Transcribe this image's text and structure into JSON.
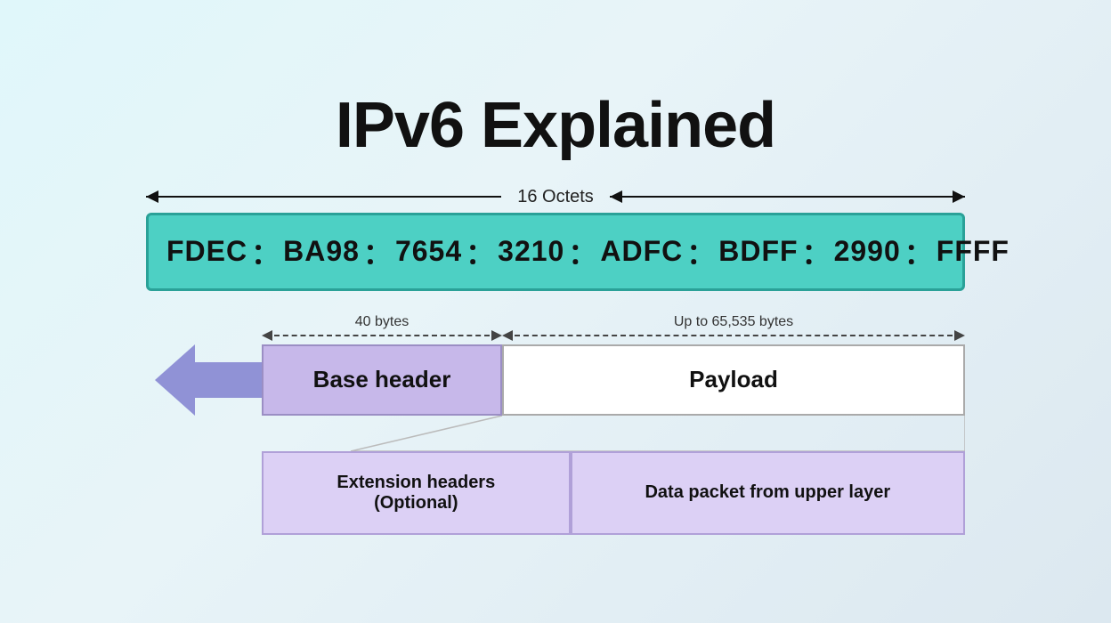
{
  "title": "IPv6 Explained",
  "octets_label": "16 Octets",
  "ipv6_segments": [
    "FDEC",
    "BA98",
    "7654",
    "3210",
    "ADFC",
    "BDFF",
    "2990",
    "FFFF"
  ],
  "ipv6_separator": "：",
  "bytes_40_label": "40 bytes",
  "bytes_65_label": "Up to 65,535 bytes",
  "base_header_label": "Base header",
  "payload_label": "Payload",
  "extension_headers_label": "Extension headers\n(Optional)",
  "data_packet_label": "Data packet from upper layer"
}
